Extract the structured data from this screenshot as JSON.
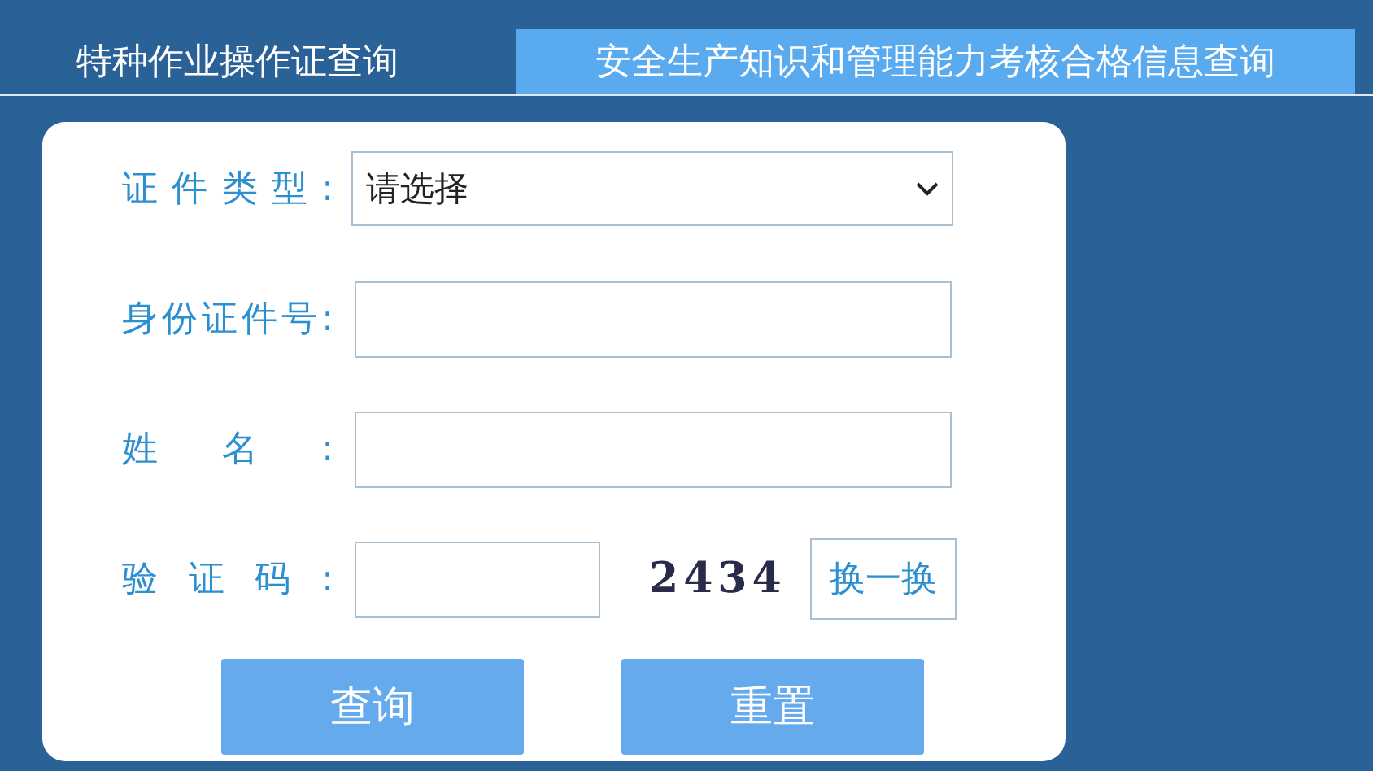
{
  "tabs": [
    {
      "label": "特种作业操作证查询",
      "selected": false
    },
    {
      "label": "安全生产知识和管理能力考核合格信息查询",
      "selected": true
    }
  ],
  "form": {
    "fields": [
      {
        "kind": "select",
        "label": "证件类型:",
        "value": "请选择"
      },
      {
        "kind": "input",
        "label": "身份证件号:"
      },
      {
        "kind": "input",
        "label": "姓名:"
      },
      {
        "kind": "captcha",
        "label": "验证码:",
        "captcha": "2434",
        "refresh": "换一换"
      }
    ],
    "buttons": [
      "查询",
      "重置"
    ]
  }
}
